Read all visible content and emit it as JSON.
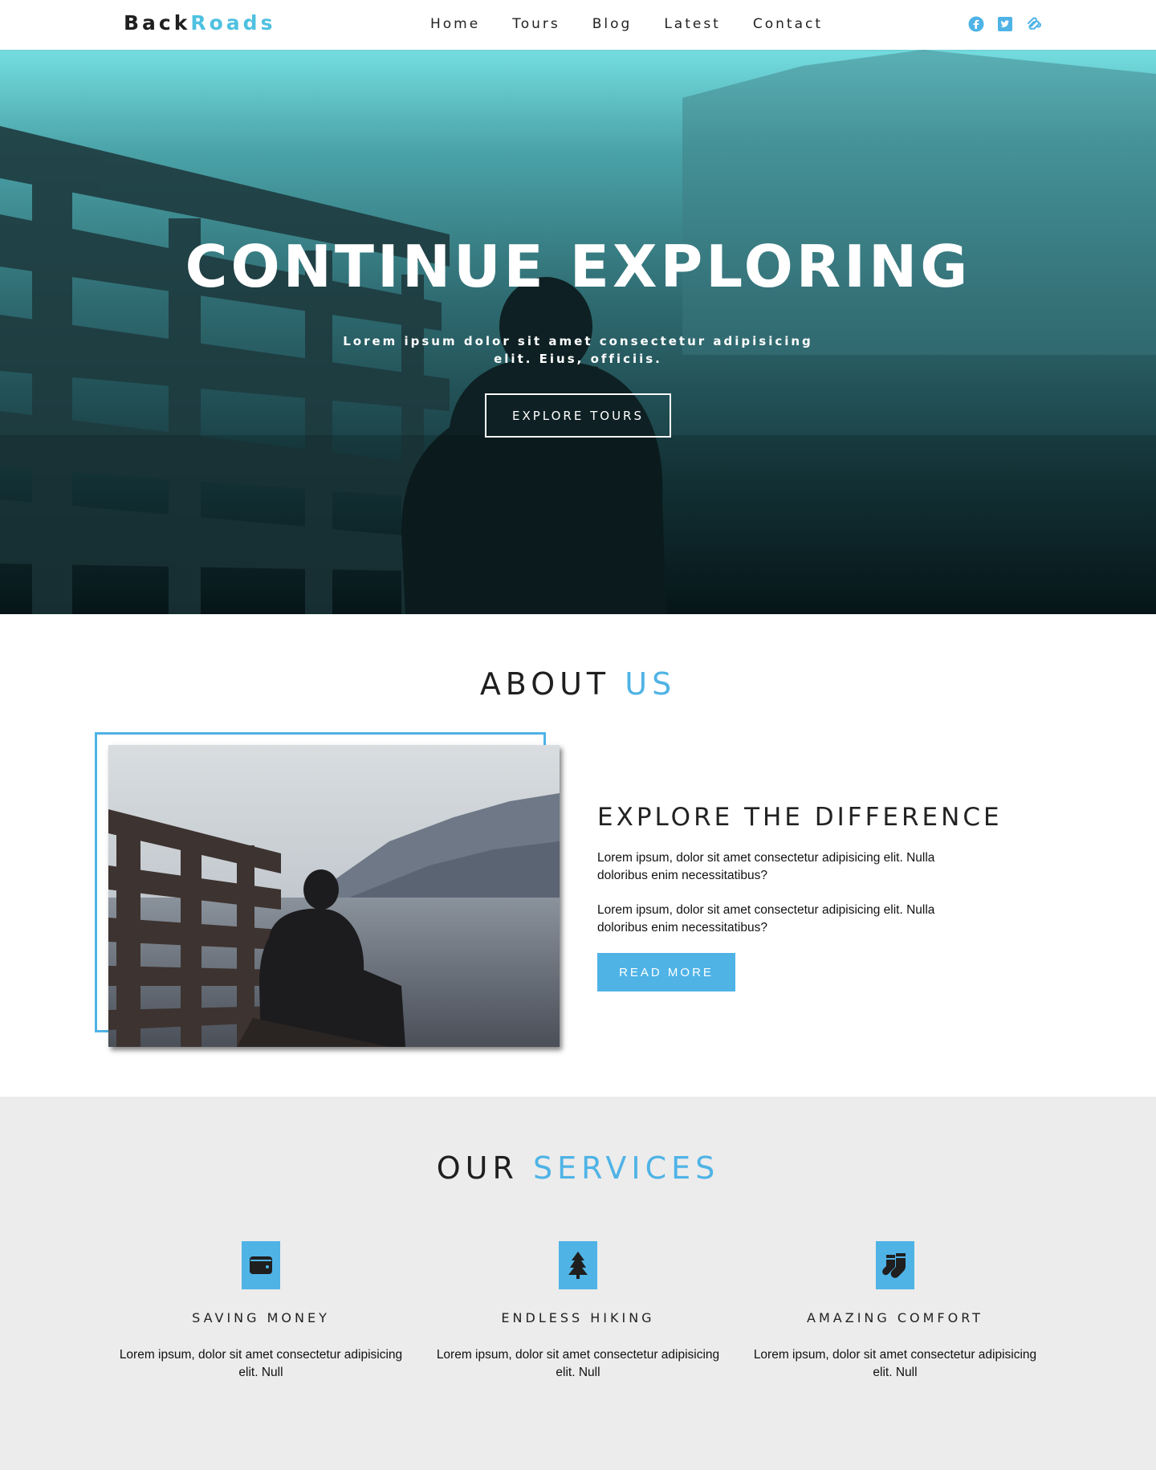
{
  "nav": {
    "logo_part1": "Back",
    "logo_part2": "Roads",
    "links": [
      "Home",
      "Tours",
      "Blog",
      "Latest",
      "Contact"
    ],
    "social_icons": [
      "facebook-icon",
      "twitter-icon",
      "squarespace-icon"
    ]
  },
  "hero": {
    "title": "CONTINUE EXPLORING",
    "subtitle": "Lorem ipsum dolor sit amet consectetur adipisicing elit. Eius, officiis.",
    "button": "EXPLORE TOURS"
  },
  "about": {
    "title_part1": "ABOUT",
    "title_part2": "US",
    "heading": "EXPLORE THE DIFFERENCE",
    "para1": "Lorem ipsum, dolor sit amet consectetur adipisicing elit. Nulla doloribus enim necessitatibus?",
    "para2": "Lorem ipsum, dolor sit amet consectetur adipisicing elit. Nulla doloribus enim necessitatibus?",
    "button": "READ MORE"
  },
  "services": {
    "title_part1": "OUR",
    "title_part2": "SERVICES",
    "items": [
      {
        "icon": "wallet-icon",
        "title": "SAVING MONEY",
        "text": "Lorem ipsum, dolor sit amet consectetur adipisicing elit. Null"
      },
      {
        "icon": "tree-icon",
        "title": "ENDLESS HIKING",
        "text": "Lorem ipsum, dolor sit amet consectetur adipisicing elit. Null"
      },
      {
        "icon": "socks-icon",
        "title": "AMAZING COMFORT",
        "text": "Lorem ipsum, dolor sit amet consectetur adipisicing elit. Null"
      }
    ]
  },
  "colors": {
    "accent": "#4fb3e6",
    "logo_accent": "#4fc1e0",
    "services_bg": "#ececec"
  }
}
